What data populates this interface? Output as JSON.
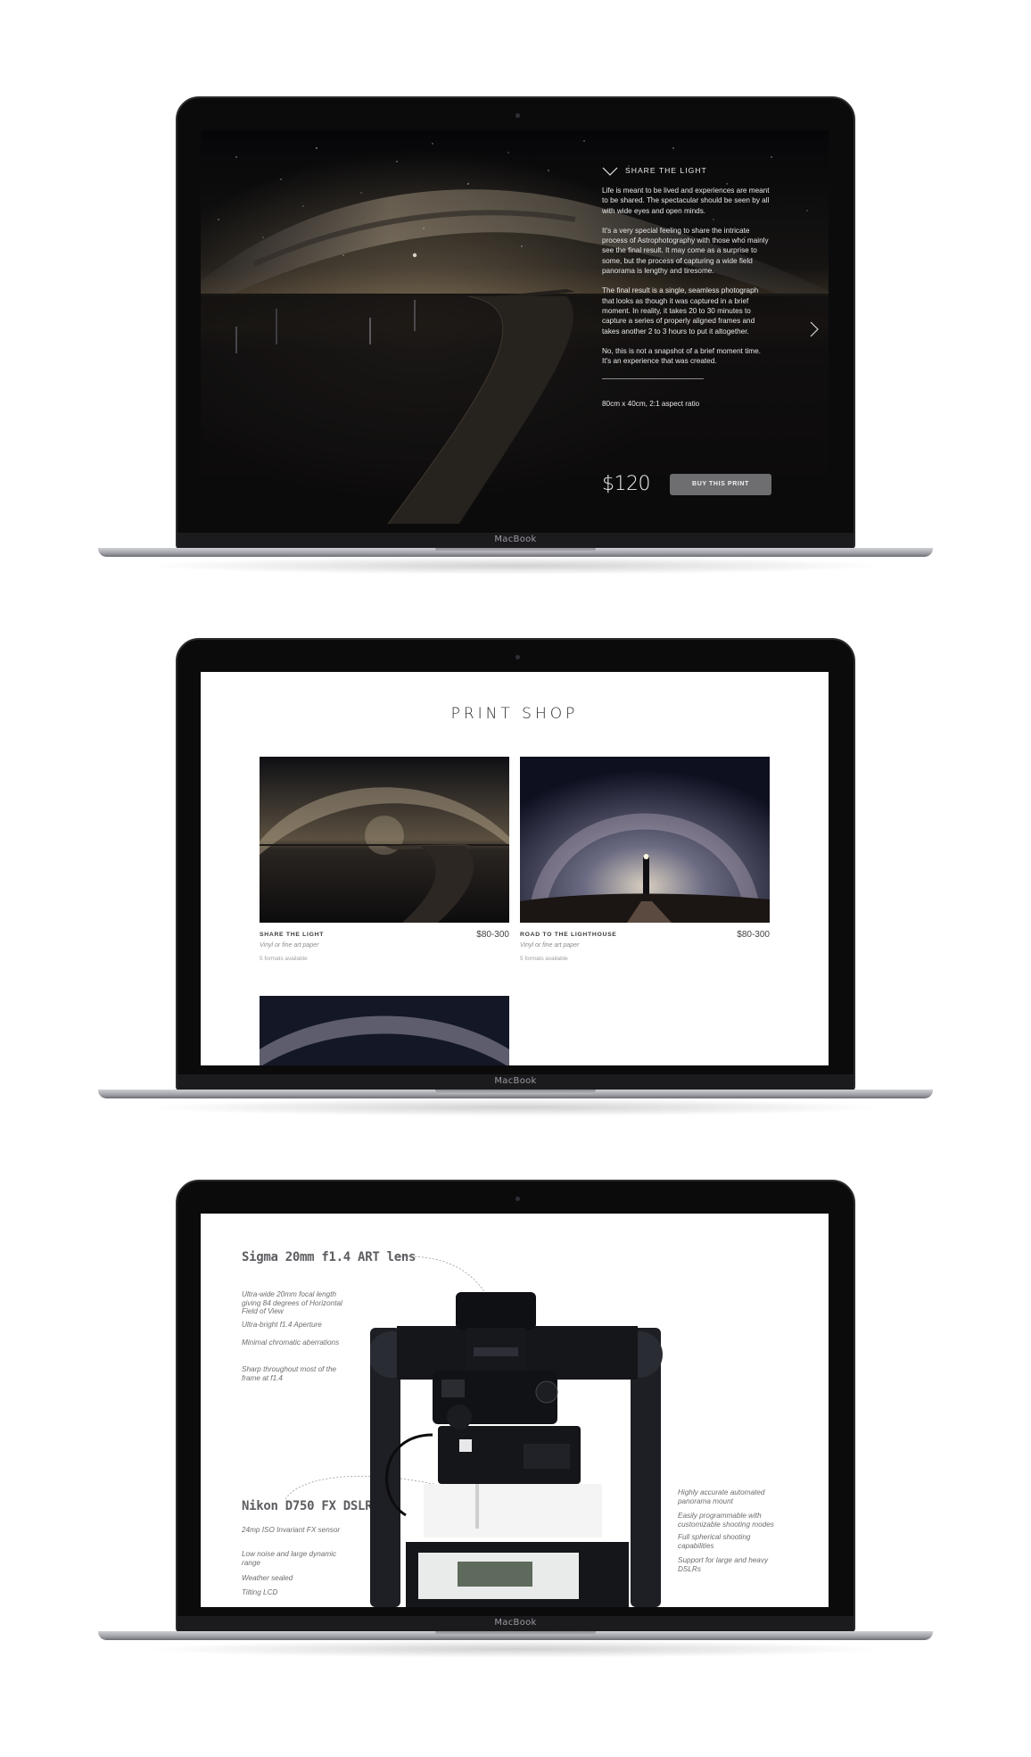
{
  "laptop_brand": "MacBook",
  "screen1": {
    "section_title": "SHARE THE LIGHT",
    "paragraphs": [
      "Life is meant to be lived and experiences are meant to be shared. The spectacular should be seen by all with wide eyes and open minds.",
      "It's a very special feeling to share the intricate process of Astrophotography with those who mainly see the final result. It may come as a surprise to some, but the process of capturing a wide field panorama is lengthy and tiresome.",
      "The final result is a single, seamless photograph that looks as though it was captured in a brief moment. In reality, it takes 20 to 30 minutes to capture a series of properly aligned frames and takes another 2 to 3 hours to put it altogether.",
      "No, this is not a snapshot of a brief moment time. It's an experience that was created."
    ],
    "spec": "80cm x 40cm, 2:1 aspect ratio",
    "price": "$120",
    "buy_label": "BUY THIS PRINT",
    "icons": {
      "collapse": "chevron-down-icon",
      "next": "chevron-right-icon"
    }
  },
  "screen2": {
    "title": "PRINT SHOP",
    "products": [
      {
        "title": "SHARE THE LIGHT",
        "price": "$80-300",
        "material": "Vinyl or fine art paper",
        "formats": "5 formats available"
      },
      {
        "title": "ROAD TO THE LIGHTHOUSE",
        "price": "$80-300",
        "material": "Vinyl or fine art paper",
        "formats": "5 formats available"
      }
    ]
  },
  "screen3": {
    "lens_title": "Sigma 20mm f1.4 ART lens",
    "lens_features": [
      "Ultra-wide 20mm focal length giving 84 degrees of Horizontal Field of View",
      "Ultra-bright f1.4 Aperture",
      "Minimal chromatic aberrations",
      "Sharp throughout most of the frame at f1.4"
    ],
    "body_title": "Nikon D750 FX DSLR",
    "body_features": [
      "24mp ISO Invariant FX sensor",
      "Low noise and large dynamic range",
      "Weather sealed",
      "Tilting LCD"
    ],
    "mount_features": [
      "Highly accurate automated panorama mount",
      "Easily programmable with customizable shooting modes",
      "Full spherical shooting capabilities",
      "Support for large and heavy DSLRs"
    ]
  }
}
